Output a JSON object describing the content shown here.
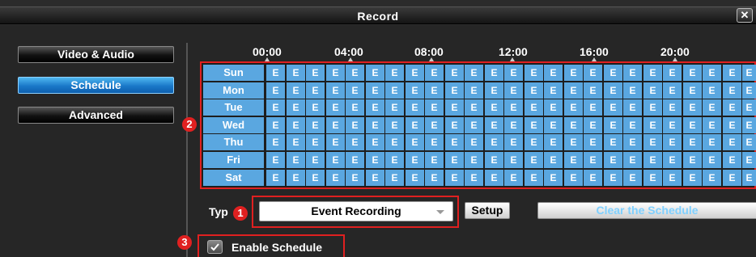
{
  "window": {
    "title": "Record",
    "close_label": "✕"
  },
  "sidebar": {
    "items": [
      {
        "label": "Video & Audio",
        "active": false
      },
      {
        "label": "Schedule",
        "active": true
      },
      {
        "label": "Advanced",
        "active": false
      }
    ]
  },
  "schedule": {
    "time_labels": [
      "00:00",
      "04:00",
      "08:00",
      "12:00",
      "16:00",
      "20:00"
    ],
    "days": [
      "Sun",
      "Mon",
      "Tue",
      "Wed",
      "Thu",
      "Fri",
      "Sat"
    ],
    "cell_mark": "E",
    "visible_hours": 25
  },
  "type_row": {
    "label": "Typ",
    "selected": "Event Recording",
    "setup_label": "Setup",
    "clear_label": "Clear the Schedule"
  },
  "enable": {
    "label": "Enable Schedule",
    "checked": true
  },
  "badges": [
    "1",
    "2",
    "3"
  ],
  "colors": {
    "cell": "#5aa7e0",
    "highlight": "#e02020",
    "active_tab": "#1a78c8"
  }
}
